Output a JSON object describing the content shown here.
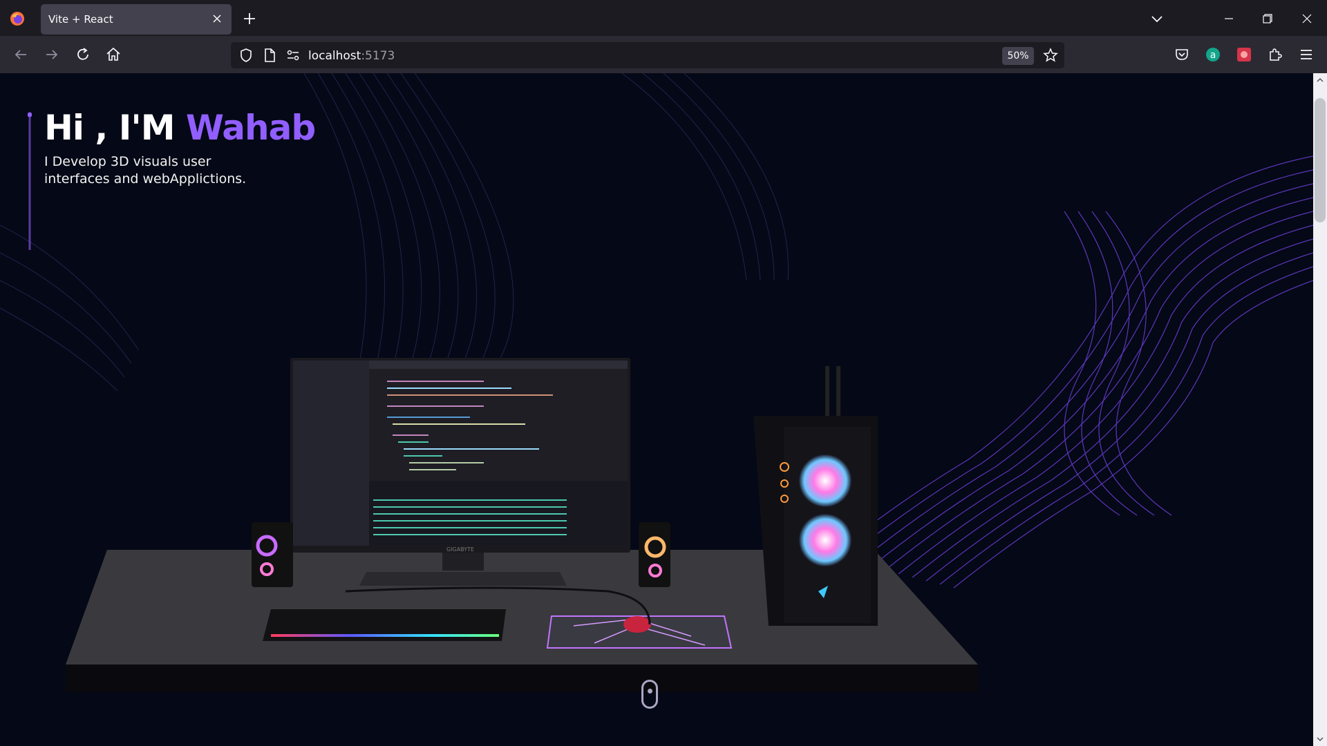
{
  "browser": {
    "tab_title": "Vite + React",
    "url_host": "localhost",
    "url_port": ":5173",
    "zoom_level": "50%"
  },
  "hero": {
    "greeting": "Hi , I'M ",
    "name": "Wahab",
    "subtitle": "I Develop 3D visuals user interfaces and webApplictions."
  },
  "scene": {
    "monitor_brand": "GIGABYTE"
  },
  "colors": {
    "accent": "#915eff",
    "background": "#050816"
  }
}
